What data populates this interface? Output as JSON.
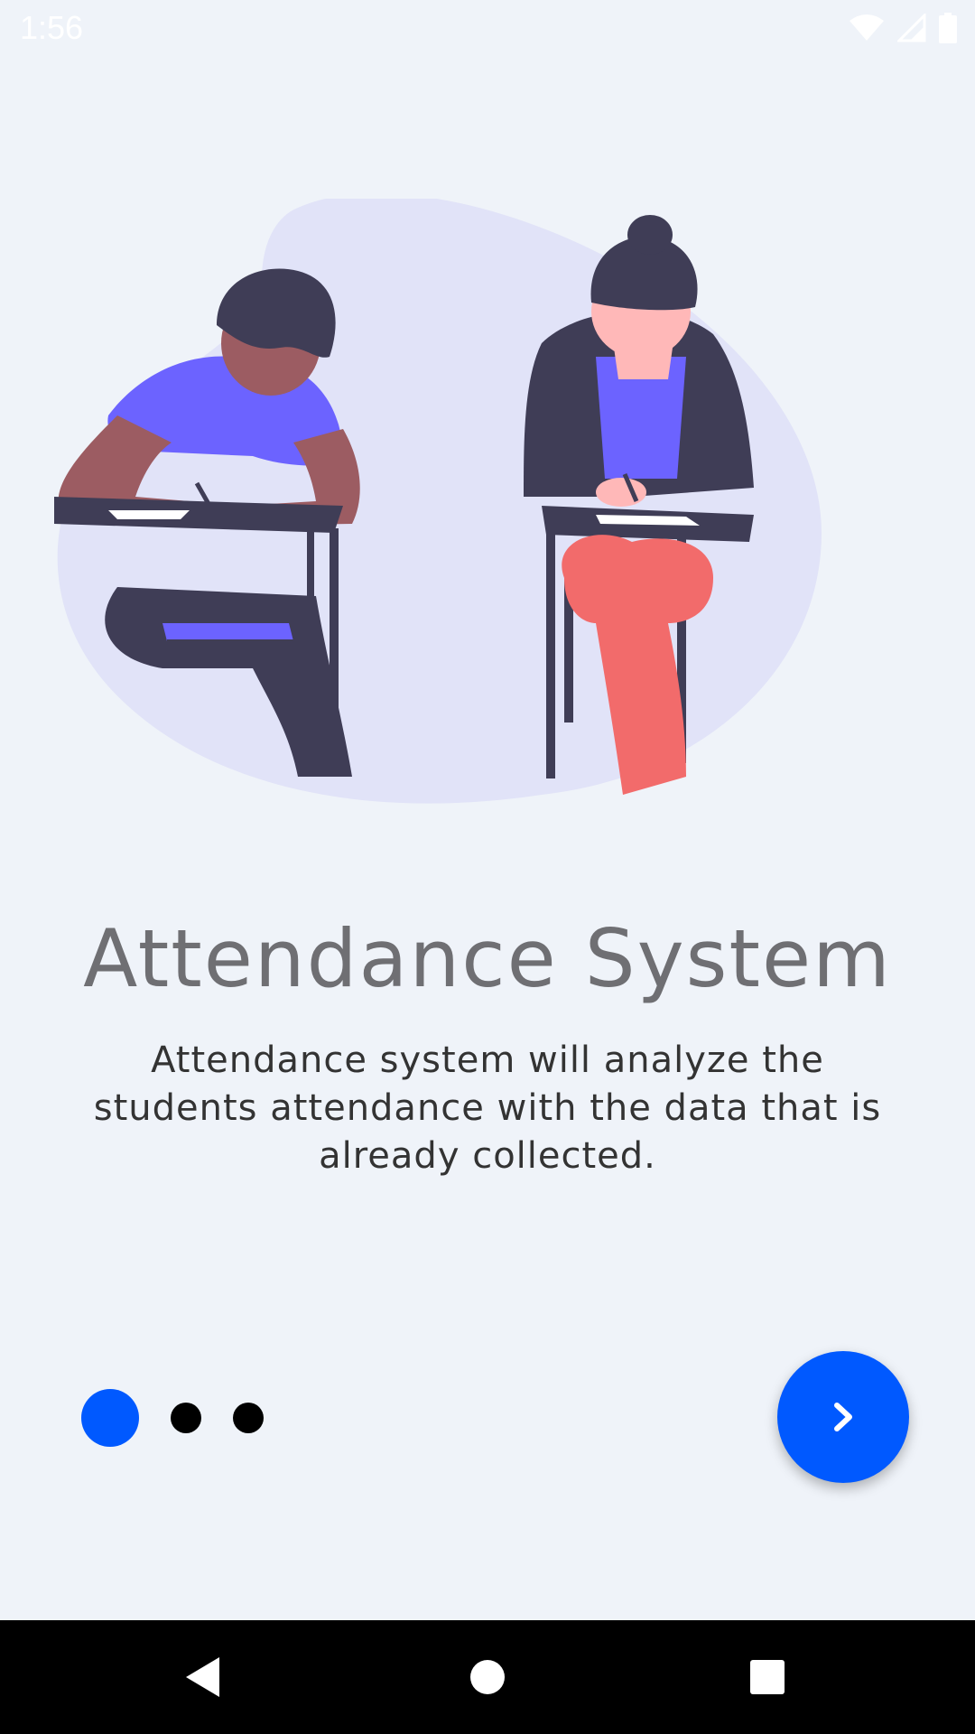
{
  "status_bar": {
    "time": "1:56",
    "icons": [
      "wifi-icon",
      "cellular-signal-icon",
      "battery-icon"
    ]
  },
  "onboarding": {
    "title": "Attendance System",
    "description": "Attendance system will analyze the students attendance with the data that is already collected.",
    "page_indicator": {
      "current": 1,
      "total": 3
    },
    "next_button_icon": "chevron-right-icon"
  },
  "navigation_bar": {
    "buttons": [
      "back-icon",
      "home-icon",
      "recents-icon"
    ]
  },
  "colors": {
    "accent": "#0059ff",
    "background": "#eff3f9",
    "title_text": "#6f6f73",
    "body_text": "#333333",
    "illustration_blob": "#e1e3f8",
    "shirt_purple": "#6c63ff",
    "pants_coral": "#f26b6b"
  }
}
